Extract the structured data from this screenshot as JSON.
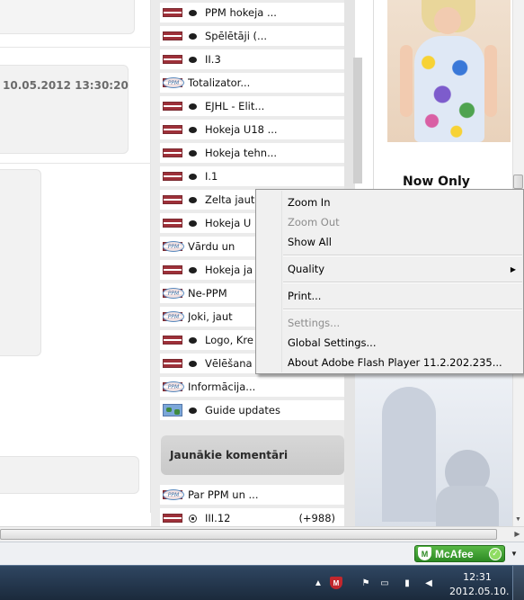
{
  "left": {
    "datetime": "10.05.2012 13:30:20"
  },
  "forum_rows": [
    {
      "icon": "flag-puck",
      "label": "PPM hokeja ..."
    },
    {
      "icon": "flag-puck",
      "label": "Spēlētāji (..."
    },
    {
      "icon": "flag-puck",
      "label": "II.3"
    },
    {
      "icon": "flag-ppm",
      "label": "Totalizator..."
    },
    {
      "icon": "flag-puck",
      "label": "EJHL - Elit..."
    },
    {
      "icon": "flag-puck",
      "label": "Hokeja U18 ..."
    },
    {
      "icon": "flag-puck",
      "label": "Hokeja tehn..."
    },
    {
      "icon": "flag-puck",
      "label": "I.1"
    },
    {
      "icon": "flag-puck",
      "label": "Zelta jautā"
    },
    {
      "icon": "flag-puck",
      "label": "Hokeja U"
    },
    {
      "icon": "flag-ppm",
      "label": "Vārdu un"
    },
    {
      "icon": "flag-puck",
      "label": "Hokeja ja"
    },
    {
      "icon": "flag-ppm",
      "label": "Ne-PPM"
    },
    {
      "icon": "flag-ppm",
      "label": "Joki, jaut"
    },
    {
      "icon": "flag-puck",
      "label": "Logo, Kre"
    },
    {
      "icon": "flag-puck",
      "label": "Vēlēšana"
    },
    {
      "icon": "flag-ppm",
      "label": "Informācija..."
    },
    {
      "icon": "globe-puck",
      "label": "Guide updates"
    }
  ],
  "comments": {
    "header": "Jaunākie komentāri",
    "rows": [
      {
        "icon": "flag-ppm",
        "label": "Par PPM un ...",
        "count": ""
      },
      {
        "icon": "flag-soccer",
        "label": "III.12",
        "count": "(+988)"
      }
    ]
  },
  "ad": {
    "text": "Now Only"
  },
  "context_menu": {
    "items": [
      {
        "label": "Zoom In",
        "enabled": true
      },
      {
        "label": "Zoom Out",
        "enabled": false
      },
      {
        "label": "Show All",
        "enabled": true
      },
      {
        "label": "Quality",
        "enabled": true,
        "submenu": true
      },
      {
        "label": "Print...",
        "enabled": true
      },
      {
        "label": "Settings...",
        "enabled": false
      },
      {
        "label": "Global Settings...",
        "enabled": true
      },
      {
        "label": "About Adobe Flash Player 11.2.202.235...",
        "enabled": true
      }
    ]
  },
  "statusbar": {
    "mcafee_label": "McAfee"
  },
  "taskbar": {
    "time": "12:31",
    "date": "2012.05.10."
  },
  "colors": {
    "latvia_flag": "#9e3039",
    "mcafee_green": "#2d8a24",
    "taskbar": "#1b2a3c"
  }
}
